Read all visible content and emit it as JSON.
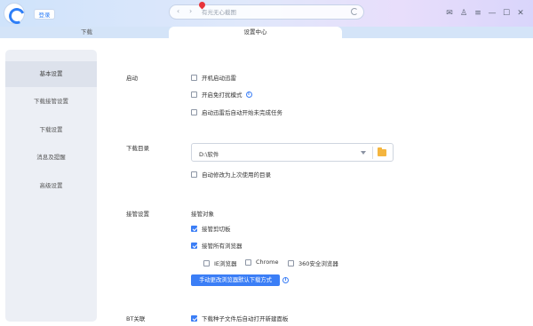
{
  "titlebar": {
    "login_label": "登录",
    "search_placeholder": "有光无心截图",
    "window_controls": [
      "mail-icon",
      "shirt-icon",
      "menu-icon",
      "minimize-icon",
      "maximize-icon",
      "close-icon"
    ]
  },
  "tabs": [
    {
      "label": "下载"
    },
    {
      "label": "设置中心"
    }
  ],
  "sidebar": {
    "items": [
      {
        "label": "基本设置",
        "active": true
      },
      {
        "label": "下载接管设置"
      },
      {
        "label": "下载设置"
      },
      {
        "label": "消息及提醒"
      },
      {
        "label": "高级设置"
      }
    ]
  },
  "settings": {
    "startup": {
      "label": "启动",
      "options": [
        {
          "label": "开机启动迅雷",
          "checked": false
        },
        {
          "label": "开启免打扰模式",
          "checked": false
        },
        {
          "label": "启动迅雷后自动开始未完成任务",
          "checked": false
        }
      ]
    },
    "download_dir": {
      "label": "下载目录",
      "value": "D:\\软件",
      "option": {
        "label": "自动修改为上次使用的目录",
        "checked": false
      }
    },
    "takeover": {
      "label": "接管设置",
      "sub_label": "接管对象",
      "clipboard": {
        "label": "接管剪切板",
        "checked": true
      },
      "all_browsers": {
        "label": "接管所有浏览器",
        "checked": true
      },
      "browsers": [
        {
          "label": "IE浏览器",
          "checked": false
        },
        {
          "label": "Chrome",
          "checked": false
        },
        {
          "label": "360安全浏览器",
          "checked": false
        }
      ],
      "button_label": "手动更改浏览器默认下载方式"
    },
    "bt": {
      "label": "BT关联",
      "option": {
        "label": "下载种子文件后自动打开新建面板",
        "checked": true
      }
    }
  },
  "colors": {
    "accent": "#3b7ef6",
    "folder": "#f4b53f",
    "pin": "#e8343a"
  }
}
